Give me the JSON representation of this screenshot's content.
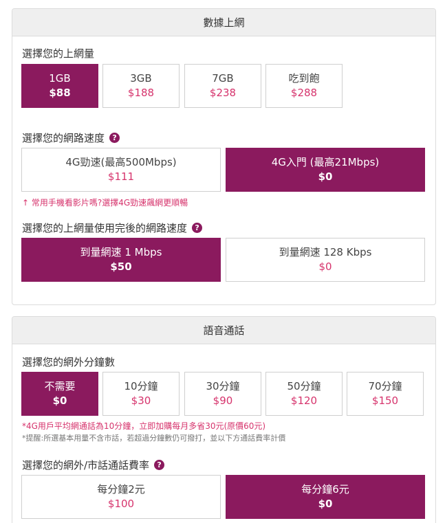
{
  "data_section": {
    "title": "數據上網",
    "volume": {
      "question": "選擇您的上網量",
      "options": [
        {
          "label": "1GB",
          "price": "$88",
          "selected": true
        },
        {
          "label": "3GB",
          "price": "$188",
          "selected": false
        },
        {
          "label": "7GB",
          "price": "$238",
          "selected": false
        },
        {
          "label": "吃到飽",
          "price": "$288",
          "selected": false
        }
      ]
    },
    "speed": {
      "question": "選擇您的網路速度",
      "options": [
        {
          "label": "4G勁速(最高500Mbps)",
          "price": "$111",
          "selected": false
        },
        {
          "label": "4G入門 (最高21Mbps)",
          "price": "$0",
          "selected": true
        }
      ],
      "note": "↑ 常用手機看影片嗎?選擇4G勁速飆網更順暢"
    },
    "after_use": {
      "question": "選擇您的上網量使用完後的網路速度",
      "options": [
        {
          "label": "到量網速 1 Mbps",
          "price": "$50",
          "selected": true
        },
        {
          "label": "到量網速 128 Kbps",
          "price": "$0",
          "selected": false
        }
      ]
    }
  },
  "voice_section": {
    "title": "語音通話",
    "minutes": {
      "question": "選擇您的網外分鐘數",
      "options": [
        {
          "label": "不需要",
          "price": "$0",
          "selected": true
        },
        {
          "label": "10分鐘",
          "price": "$30",
          "selected": false
        },
        {
          "label": "30分鐘",
          "price": "$90",
          "selected": false
        },
        {
          "label": "50分鐘",
          "price": "$120",
          "selected": false
        },
        {
          "label": "70分鐘",
          "price": "$150",
          "selected": false
        }
      ],
      "note1": "*4G用戶平均網通話為10分鐘，立即加購每月多省30元(原價60元)",
      "note2": "*提醒:所選基本用量不含市話，若超過分鐘數仍可撥打，並以下方通話費率計價"
    },
    "rate": {
      "question": "選擇您的網外/市話通話費率",
      "options": [
        {
          "label": "每分鐘2元",
          "price": "$100",
          "selected": false
        },
        {
          "label": "每分鐘6元",
          "price": "$0",
          "selected": true
        }
      ]
    }
  },
  "colors": {
    "accent": "#8b1a5e",
    "price": "#d6336c"
  },
  "icons": {
    "help": "question-circle-icon"
  }
}
